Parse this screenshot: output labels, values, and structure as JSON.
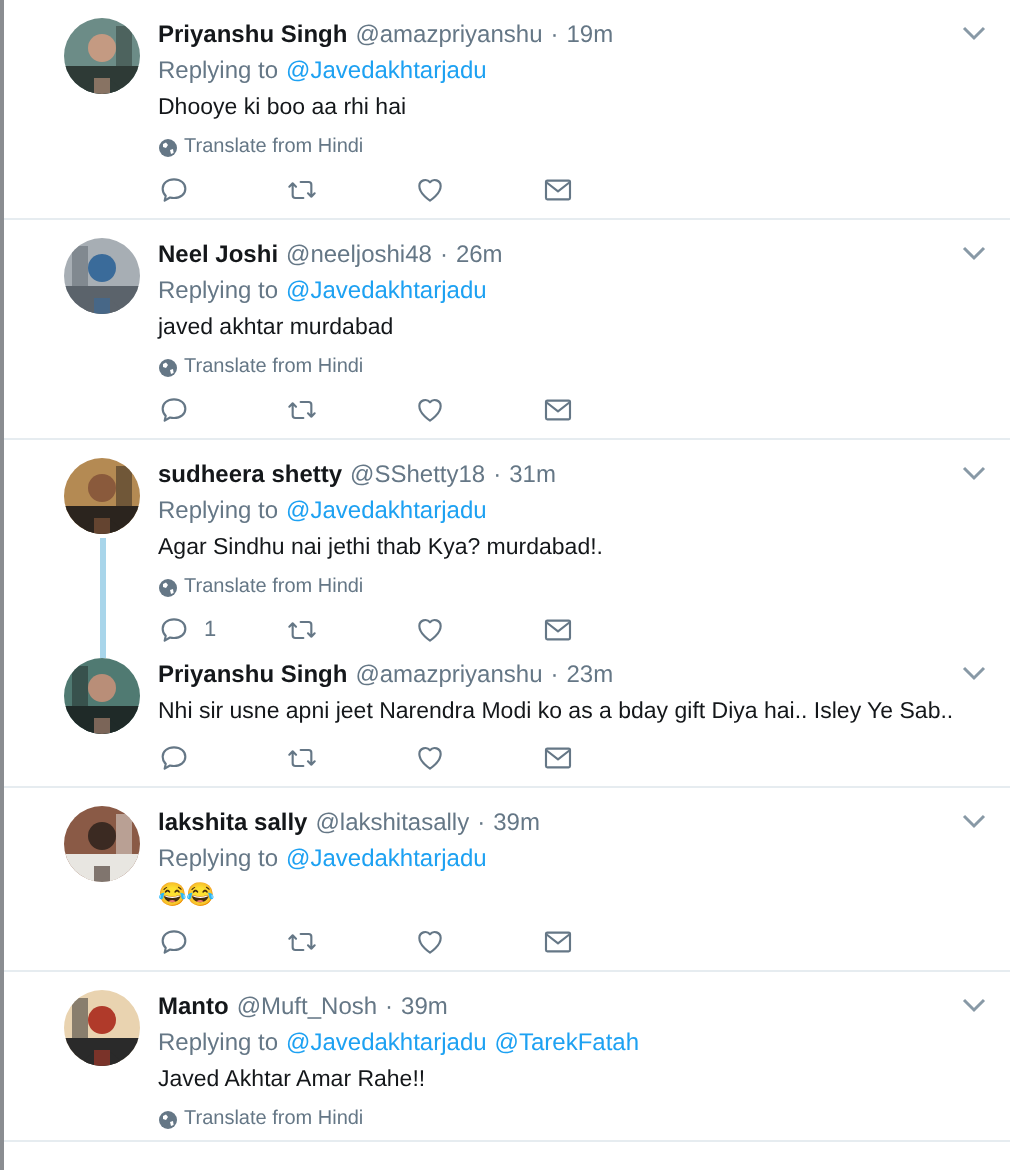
{
  "tweets": [
    {
      "name": "Priyanshu Singh",
      "handle": "@amazpriyanshu",
      "separator": "·",
      "time": "19m",
      "replying_label": "Replying to",
      "replying_to": [
        "@Javedakhtarjadu"
      ],
      "text": "Dhooye ki boo aa rhi hai",
      "translate": "Translate from Hindi",
      "thread_continues": false,
      "show_actions": true,
      "avatar": {
        "kind": "picture"
      }
    },
    {
      "name": "Neel Joshi",
      "handle": "@neeljoshi48",
      "separator": "·",
      "time": "26m",
      "replying_label": "Replying to",
      "replying_to": [
        "@Javedakhtarjadu"
      ],
      "text": "javed akhtar murdabad",
      "translate": "Translate from Hindi",
      "thread_continues": false,
      "show_actions": true,
      "avatar": {
        "kind": "picture"
      }
    },
    {
      "name": "sudheera shetty",
      "handle": "@SShetty18",
      "separator": "·",
      "time": "31m",
      "replying_label": "Replying to",
      "replying_to": [
        "@Javedakhtarjadu"
      ],
      "text": "Agar Sindhu nai jethi thab Kya? murdabad!.",
      "translate": "Translate from Hindi",
      "reply_count": "1",
      "thread_continues": true,
      "show_actions": true,
      "avatar": {
        "kind": "picture"
      }
    },
    {
      "name": "Priyanshu Singh",
      "handle": "@amazpriyanshu",
      "separator": "·",
      "time": "23m",
      "text": "Nhi sir usne apni jeet Narendra Modi ko as a bday gift Diya hai.. Isley Ye Sab..",
      "thread_continues": false,
      "show_actions": true,
      "avatar": {
        "kind": "picture"
      }
    },
    {
      "name": "lakshita sally",
      "handle": "@lakshitasally",
      "separator": "·",
      "time": "39m",
      "replying_label": "Replying to",
      "replying_to": [
        "@Javedakhtarjadu"
      ],
      "text": "😂😂",
      "thread_continues": false,
      "show_actions": true,
      "avatar": {
        "kind": "picture"
      }
    },
    {
      "name": "Manto",
      "handle": "@Muft_Nosh",
      "separator": "·",
      "time": "39m",
      "replying_label": "Replying to",
      "replying_to": [
        "@Javedakhtarjadu",
        "@TarekFatah"
      ],
      "text": "Javed Akhtar Amar Rahe!!",
      "translate": "Translate from Hindi",
      "thread_continues": false,
      "show_actions": false,
      "avatar": {
        "kind": "picture"
      }
    }
  ]
}
